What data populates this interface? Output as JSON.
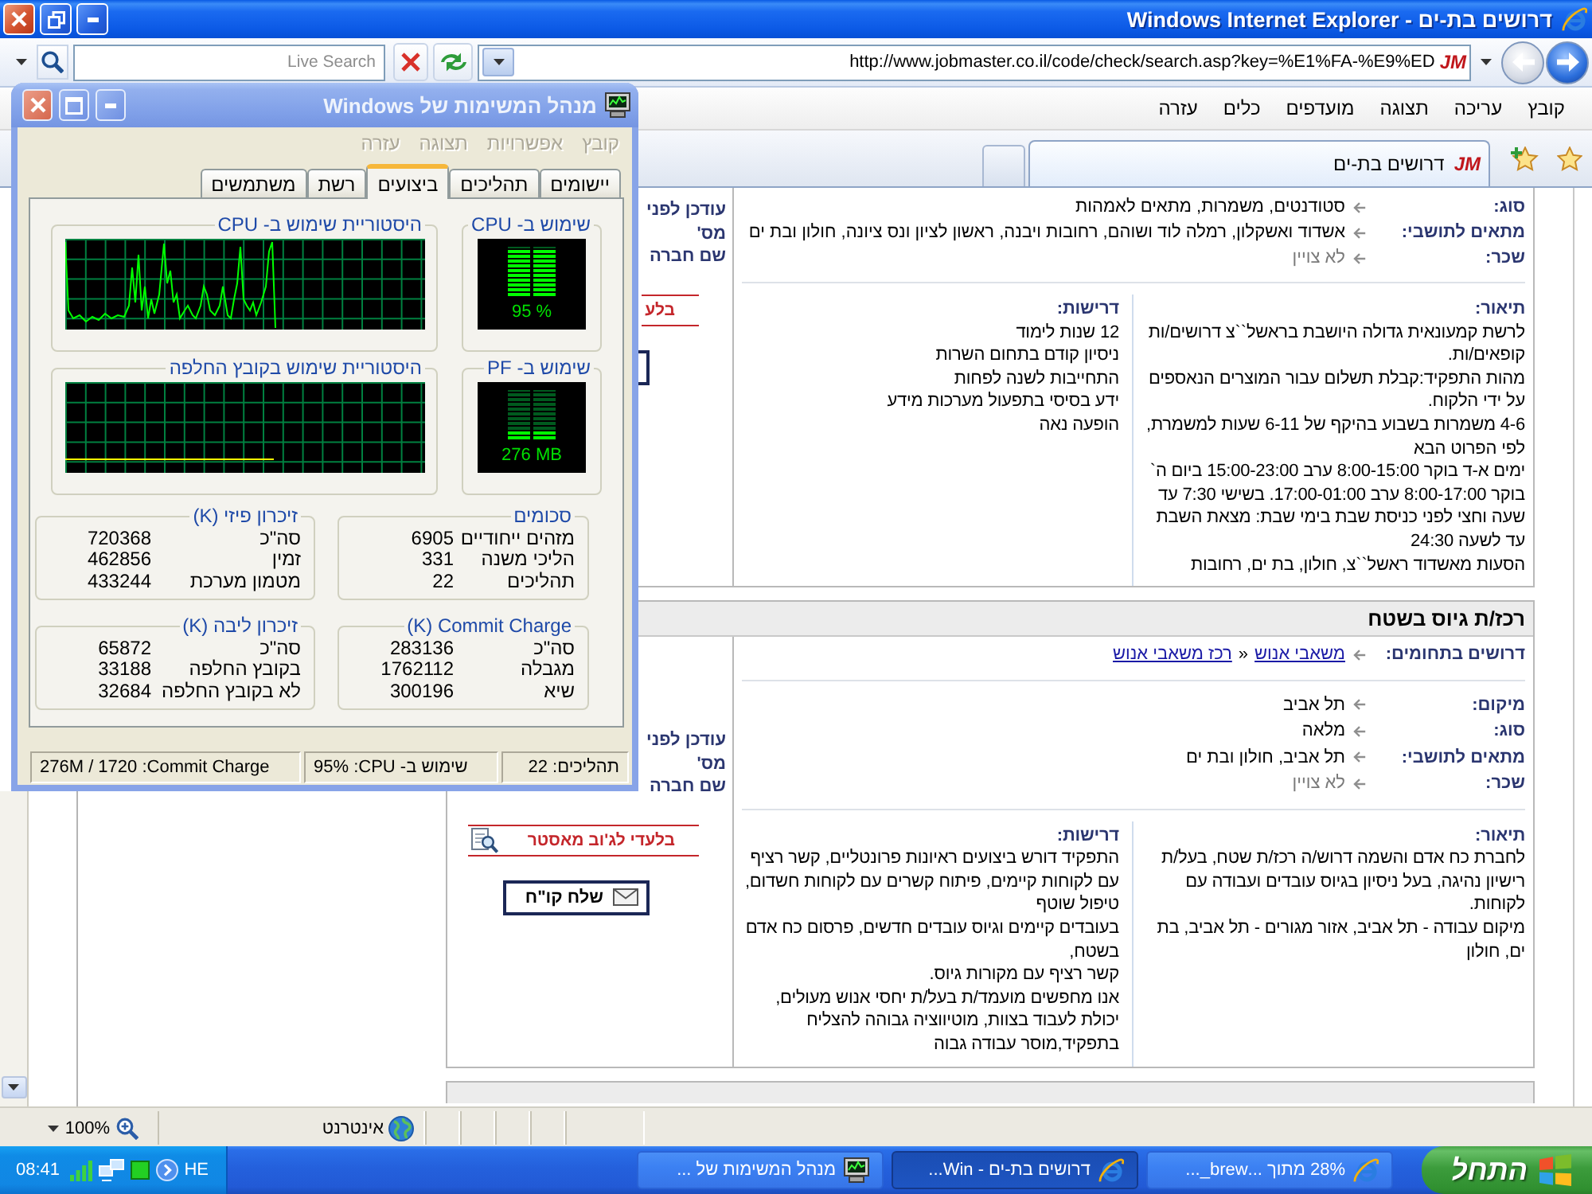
{
  "browser": {
    "title": "דרושים בת-ים - Windows Internet Explorer",
    "nav_buttons": [
      {
        "kind": "back",
        "disabled": false
      },
      {
        "kind": "forward",
        "disabled": true
      }
    ],
    "address": {
      "logo": "JM",
      "url": "http://www.jobmaster.co.il/code/check/search.asp?key=%E1%FA-%E9%ED"
    },
    "search": {
      "placeholder": "Live Search"
    },
    "menu": [
      "קובץ",
      "עריכה",
      "תצוגה",
      "מועדפים",
      "כלים",
      "עזרה"
    ],
    "tabs": [
      {
        "logo": "JM",
        "label": "דרושים בת-ים",
        "selected": true
      }
    ],
    "status_bar": {
      "zone": "אינטרנט",
      "zoom": "100%"
    }
  },
  "listings": [
    {
      "kind": "cut-top",
      "fields": [
        {
          "label": "סוג:",
          "value": "סטודנטים, משמרות, מתאים לאמהות",
          "kind": "text"
        },
        {
          "label": "מתאים לתושבי:",
          "value": "אשדוד ואשקלון, רמלה לוד ושוהם, רחובות ויבנה, ראשון לציון ונס ציונה, חולון ובת ים",
          "kind": "text"
        },
        {
          "label": "שכר:",
          "value": "לא צויין",
          "kind": "unspecified"
        }
      ],
      "description": {
        "heading": "תיאור:",
        "paragraphs": [
          "לרשת קמעונאית גדולה היושבת בראשל``צ דרושים/ות קופאים/ות.",
          "מהות התפקיד:קבלת תשלום עבור המוצרים הנאספים על ידי הלקוח.",
          "4-6 משמרות בשבוע בהיקף של 6-11 שעות למשמרת, לפי הפרוט הבא",
          "ימים א-ד בוקר 8:00-15:00 ערב 15:00-23:00 ביום ה` בוקר 8:00-17:00 ערב 17:00-01:00. בשישי 7:30 עד שעה וחצי לפני כניסת שבת בימי שבת: מצאת השבת עד לשעה 24:30",
          "הסעות מאשדוד ראשל``צ, חולון, בת ים, רחובות"
        ]
      },
      "requirements": {
        "heading": "דרישות:",
        "paragraphs": [
          "12 שנות לימוד",
          "ניסיון קודם בתחום השרות",
          "התחייבות לשנה לפחות",
          "ידע בסיסי בתפעול מערכות מידע",
          "הופעה נאה"
        ]
      },
      "side": {
        "labels": [
          "עודכן לפני",
          "מס'",
          "שם חברה"
        ],
        "exclusive": {
          "label": "בלע"
        },
        "send_cv": {
          "covered": true
        }
      }
    },
    {
      "kind": "full",
      "title": "רכז/ת גיוס בשטח",
      "categories": {
        "label": "דרושים בתחומים:",
        "links": [
          "משאבי אנוש",
          "רכז משאבי אנוש"
        ],
        "separator": "»"
      },
      "fields": [
        {
          "label": "מיקום:",
          "value": "תל אביב",
          "kind": "text"
        },
        {
          "label": "סוג:",
          "value": "מלאה",
          "kind": "text"
        },
        {
          "label": "מתאים לתושבי:",
          "value": "תל אביב, חולון ובת ים",
          "kind": "text"
        },
        {
          "label": "שכר:",
          "value": "לא צויין",
          "kind": "unspecified"
        }
      ],
      "description": {
        "heading": "תיאור:",
        "paragraphs": [
          "לחברת כח אדם והשמה דרוש/ה רכז/ת שטח, בעל/ת רישיון נהיגה, בעל ניסיון בגיוס עובדים ועבודה עם לקוחות.",
          "מיקום עבודה - תל אביב, אזור מגורים - תל אביב, בת ים, חולון"
        ]
      },
      "requirements": {
        "heading": "דרישות:",
        "paragraphs": [
          "התפקיד דורש ביצועים ראיונות פרונטליים, קשר רציף עם לקוחות קיימים, פיתוח קשרים עם לקוחות חשדום, טיפול שוטף",
          "בעובדים קיימים וגיוס עובדים חדשים, פרסום כח אדם בשטח,",
          "קשר רציף עם מקורות גיוס.",
          "אנו מחפשים מועמד/ת בעל/ת יחסי אנוש מעולים, יכולת לעבוד בצוות, מוטיווציה גבוהה להצליח בתפקיד,מוסר עבודה גבוה"
        ]
      },
      "side": {
        "labels": [
          "עודכן לפני",
          "מס'",
          "שם חברה"
        ],
        "exclusive": {
          "label": "בלעדי לג'וב מאסטר",
          "icon": true
        },
        "send_cv": {
          "label": "שלח קו\"ח"
        }
      }
    },
    {
      "kind": "cut-bottom"
    }
  ],
  "task_manager": {
    "title": "מנהל המשימות של Windows",
    "menu": [
      {
        "label": "קובץ",
        "disabled": true
      },
      {
        "label": "אפשרויות",
        "disabled": true
      },
      {
        "label": "תצוגה",
        "disabled": true
      },
      {
        "label": "עזרה",
        "disabled": true
      }
    ],
    "tabs": [
      {
        "label": "יישומים",
        "selected": false
      },
      {
        "label": "תהליכים",
        "selected": false
      },
      {
        "label": "ביצועים",
        "selected": true
      },
      {
        "label": "רשת",
        "selected": false
      },
      {
        "label": "משתמשים",
        "selected": false
      }
    ],
    "meters": [
      {
        "title": "שימוש ב- CPU",
        "reading": "95 %",
        "level": 0.95
      },
      {
        "title": "שימוש ב- PF",
        "reading": "276 MB",
        "level": 0.16
      }
    ],
    "histories": [
      {
        "title": "היסטוריית שימוש ב- CPU",
        "kind": "cpu"
      },
      {
        "title": "היסטוריית שימוש בקובץ החלפה",
        "kind": "page-file"
      }
    ],
    "groups": [
      {
        "title": "סכומים",
        "rows": [
          {
            "label": "מזהים ייחודיים",
            "value": "6905"
          },
          {
            "label": "הליכי משנה",
            "value": "331"
          },
          {
            "label": "תהליכים",
            "value": "22"
          }
        ]
      },
      {
        "title": "זיכרון פיזי (K)",
        "rows": [
          {
            "label": "סה\"כ",
            "value": "720368"
          },
          {
            "label": "זמין",
            "value": "462856"
          },
          {
            "label": "מטמון מערכת",
            "value": "433244"
          }
        ]
      },
      {
        "title": "(K) Commit Charge",
        "rows": [
          {
            "label": "סה\"כ",
            "value": "283136"
          },
          {
            "label": "מגבלה",
            "value": "1762112"
          },
          {
            "label": "שיא",
            "value": "300196"
          }
        ]
      },
      {
        "title": "זיכרון ליבה (K)",
        "rows": [
          {
            "label": "סה\"כ",
            "value": "65872"
          },
          {
            "label": "בקובץ החלפה",
            "value": "33188"
          },
          {
            "label": "לא בקובץ החלפה",
            "value": "32684"
          }
        ]
      }
    ],
    "status_bar": [
      "תהליכים: 22",
      "95% :CPU -שימוש ב",
      "276M / 1720 :Commit Charge"
    ]
  },
  "taskbar": {
    "start": "התחל",
    "buttons": [
      {
        "label": "28% מתוך ...brew_...",
        "kind": "browser",
        "selected": false
      },
      {
        "label": "דרושים בת-ים - Win...",
        "kind": "browser",
        "selected": true
      },
      {
        "label": "מנהל המשימות של ...",
        "kind": "task-manager",
        "selected": false
      }
    ],
    "tray": {
      "language": "HE",
      "clock": "08:41"
    }
  }
}
